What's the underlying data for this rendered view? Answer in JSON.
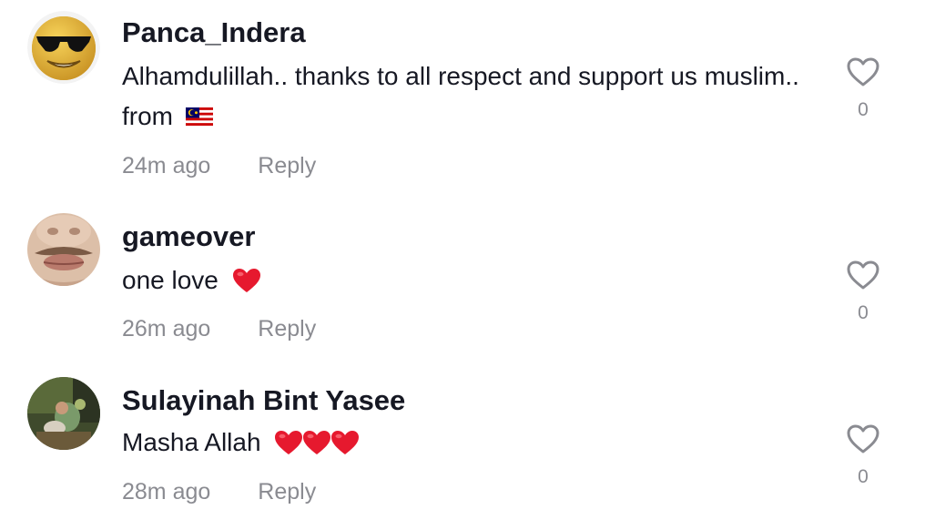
{
  "comments": [
    {
      "username": "Panca_Indera",
      "text": "Alhamdulillah.. thanks to all respect and support us muslim.. from",
      "emoji": "flag-malaysia",
      "time": "24m ago",
      "reply_label": "Reply",
      "like_count": "0"
    },
    {
      "username": "gameover",
      "text": "one love",
      "emoji": "red-heart",
      "time": "26m ago",
      "reply_label": "Reply",
      "like_count": "0"
    },
    {
      "username": "Sulayinah Bint Yasee",
      "text": "Masha Allah",
      "emoji": "red-heart-x3",
      "time": "28m ago",
      "reply_label": "Reply",
      "like_count": "0"
    }
  ],
  "colors": {
    "text_primary": "#161823",
    "text_secondary": "#8a8b91",
    "heart_red": "#e6192e"
  },
  "icons": {
    "like": "heart-outline-icon"
  }
}
